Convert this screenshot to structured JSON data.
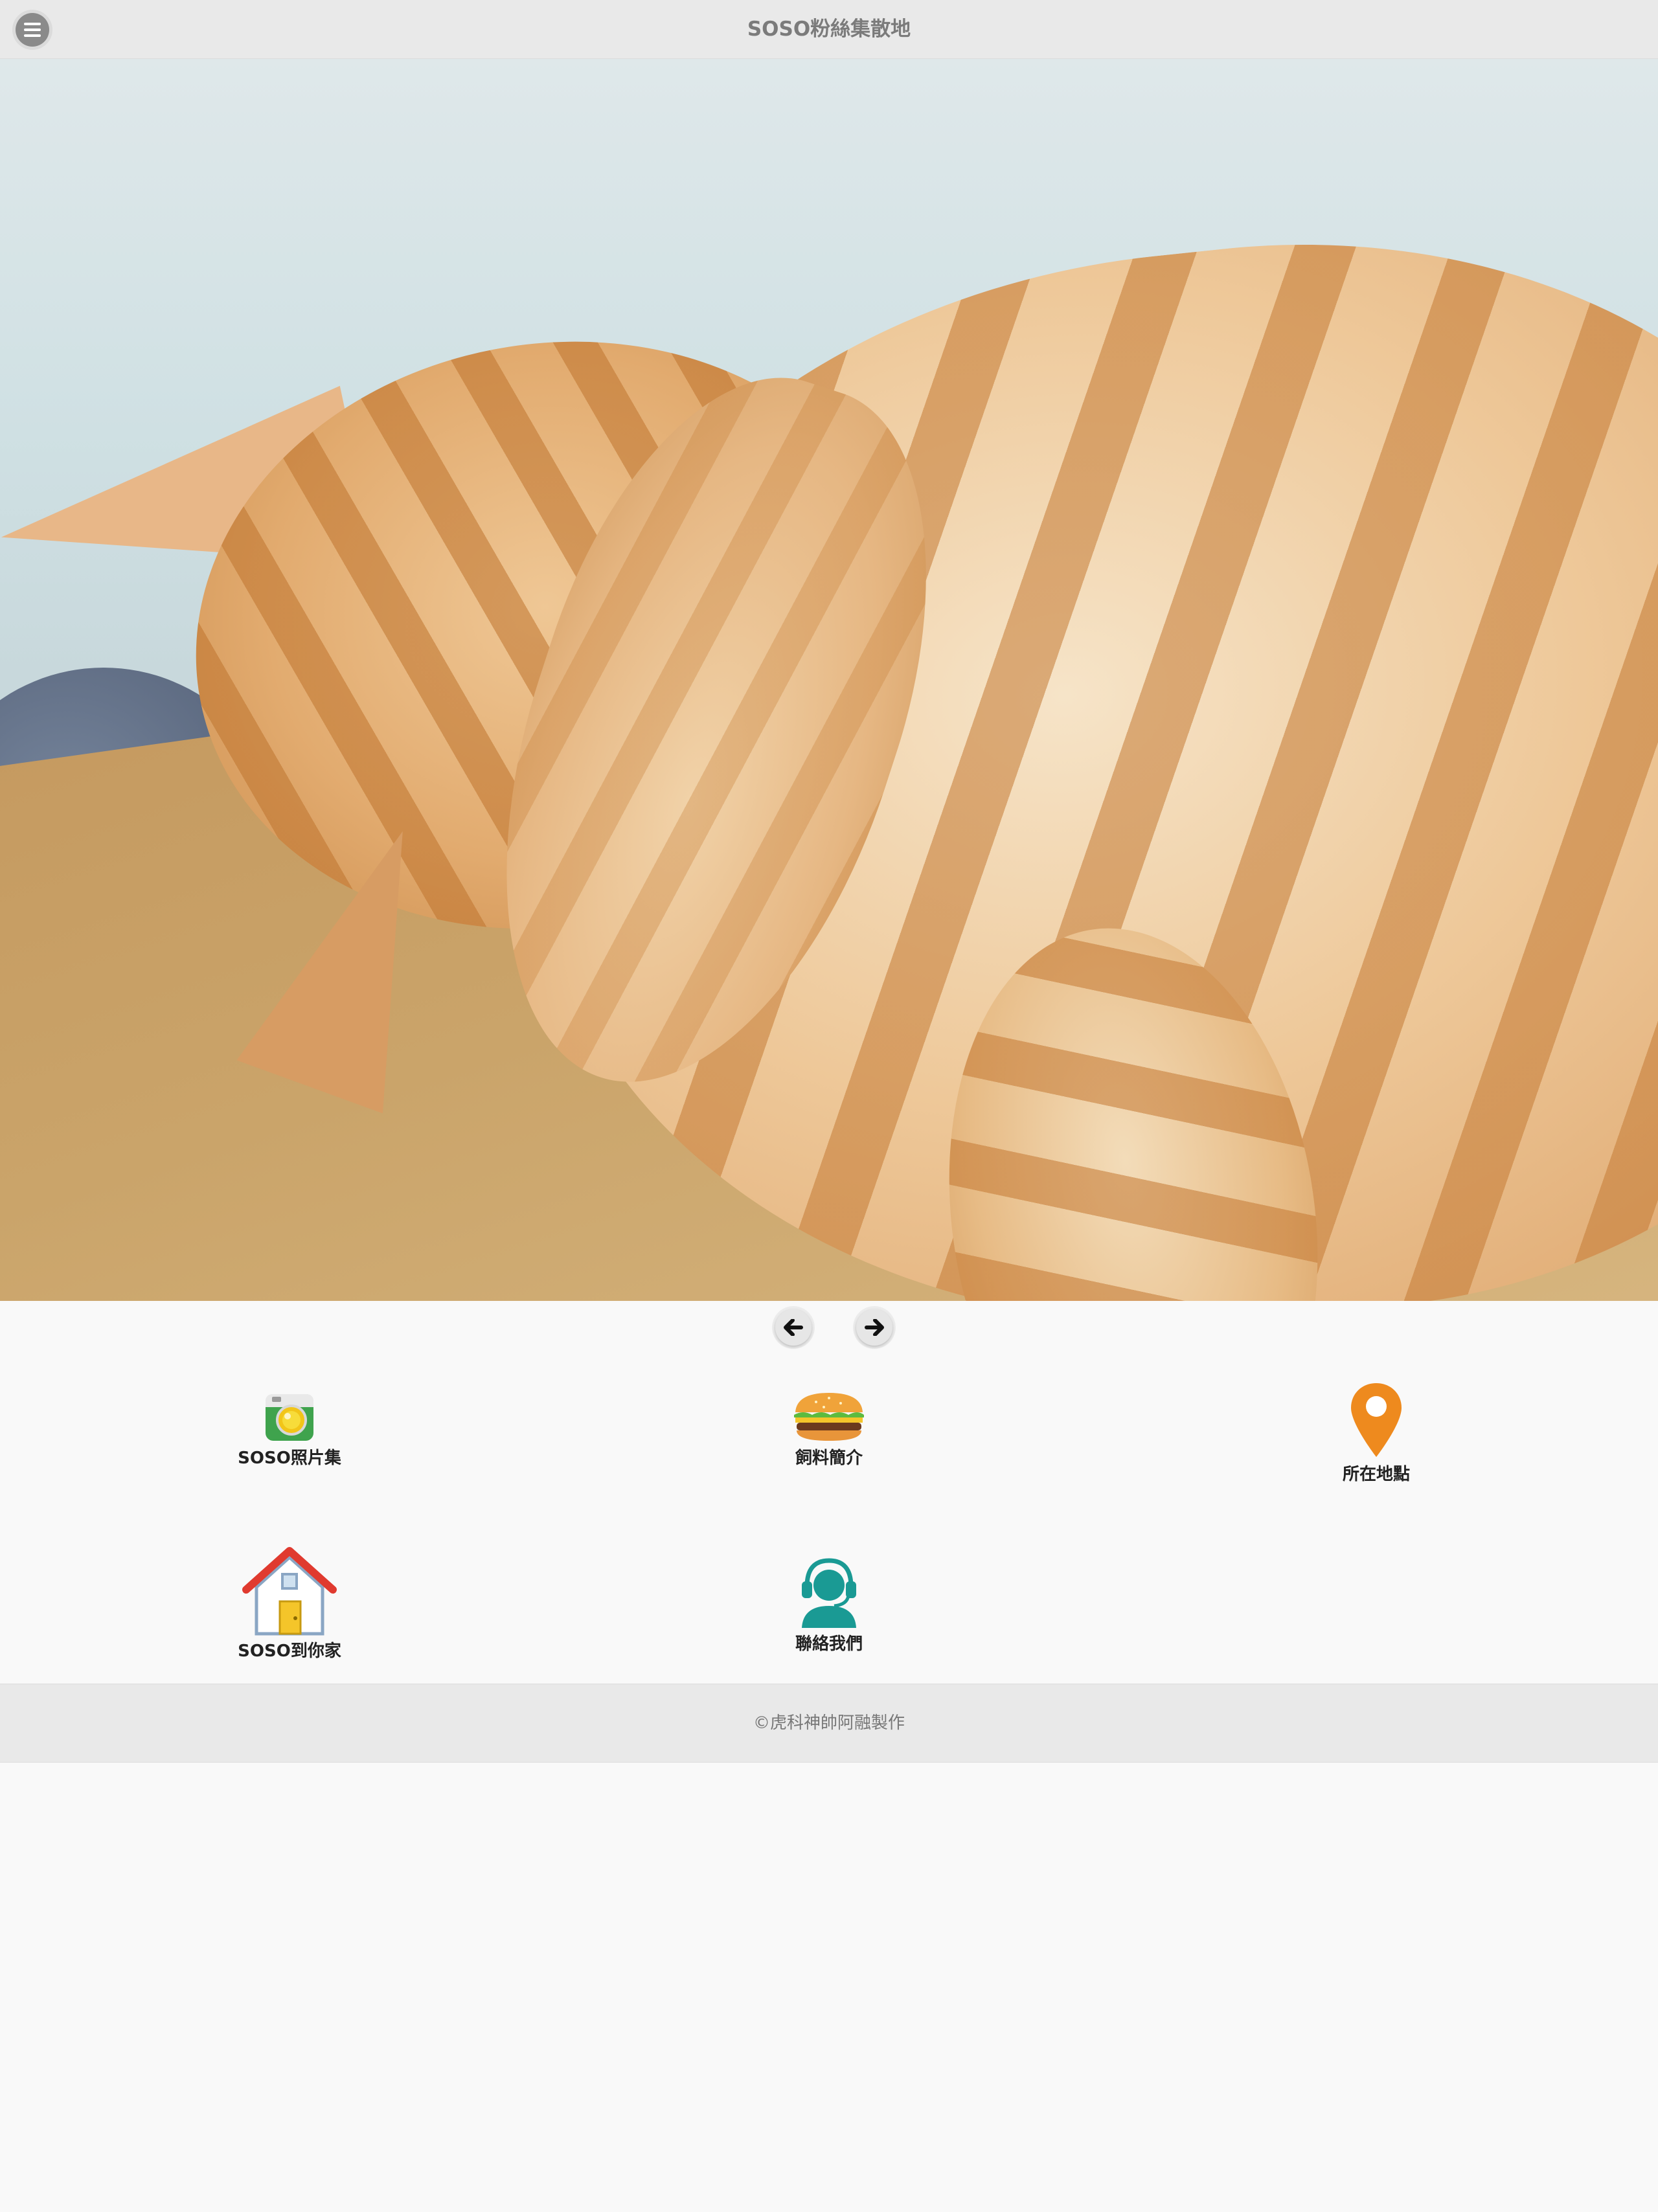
{
  "header": {
    "title": "SOSO粉絲集散地",
    "menu_icon": "hamburger-menu-icon"
  },
  "hero": {
    "description_icon": "cat-photo"
  },
  "carousel": {
    "prev_icon": "arrow-left-icon",
    "next_icon": "arrow-right-icon"
  },
  "menu": {
    "items": [
      {
        "label": "SOSO照片集",
        "icon": "camera-icon"
      },
      {
        "label": "飼料簡介",
        "icon": "hamburger-food-icon"
      },
      {
        "label": "所在地點",
        "icon": "map-pin-icon"
      },
      {
        "label": "SOSO到你家",
        "icon": "house-icon"
      },
      {
        "label": "聯絡我們",
        "icon": "support-headset-icon"
      }
    ]
  },
  "footer": {
    "text": "©虎科神帥阿融製作"
  },
  "colors": {
    "header_bg": "#e9e9e9",
    "page_bg": "#f9f9f9",
    "pin_orange": "#ee8a1e",
    "contact_teal": "#1a9a94",
    "house_red": "#e03a2f"
  }
}
